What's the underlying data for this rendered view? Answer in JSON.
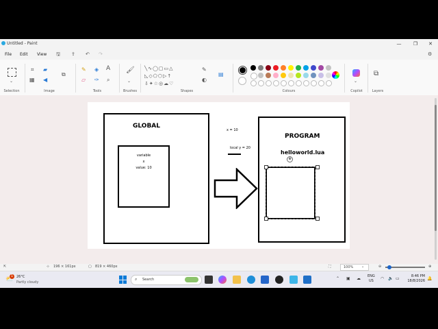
{
  "window": {
    "title": "Untitled - Paint",
    "app_icon": "paint-icon",
    "controls": [
      "minimize-icon",
      "restore-icon",
      "close-icon"
    ]
  },
  "menu": {
    "file": "File",
    "edit": "Edit",
    "view": "View",
    "quick_icons": [
      "save-icon",
      "share-icon",
      "undo-icon",
      "redo-icon"
    ],
    "settings_icon": "gear-icon"
  },
  "ribbon": {
    "groups": {
      "selection": "Selection",
      "image": "Image",
      "tools": "Tools",
      "brushes": "Brushes",
      "shapes": "Shapes",
      "colours": "Colours",
      "copilot": "Copilot",
      "layers": "Layers"
    },
    "colors": {
      "primary": "#000000",
      "secondary": "#ffffff",
      "palette_row1": [
        "#000000",
        "#7f7f7f",
        "#880015",
        "#ed1c24",
        "#ff7f27",
        "#fff200",
        "#22b14c",
        "#00a2e8",
        "#3f48cc",
        "#a349a4",
        "#c3c3c3"
      ],
      "palette_row2": [
        "#ffffff",
        "#c3c3c3",
        "#b97a57",
        "#ffaec9",
        "#ffc90e",
        "#efe4b0",
        "#b5e61d",
        "#99d9ea",
        "#7092be",
        "#c8bfe7",
        "#e0e0e0"
      ]
    }
  },
  "canvas": {
    "global_box": {
      "title": "GLOBAL",
      "inner_lines": [
        "variable",
        "x",
        "value: 10"
      ]
    },
    "x_label": "x = 10",
    "local_label": "local y = 20",
    "program_box": {
      "title": "PROGRAM",
      "file": "helloworld.lua"
    }
  },
  "status": {
    "cursor_pos": "196 × 161px",
    "canvas_size": "819 × 460px",
    "zoom": "100%"
  },
  "taskbar": {
    "weather_temp": "26°C",
    "weather_desc": "Partly cloudy",
    "weather_badge": "1",
    "search_placeholder": "Search",
    "lang_top": "ENG",
    "lang_bottom": "US",
    "time": "8:46 PM",
    "date": "18/8/2026"
  }
}
